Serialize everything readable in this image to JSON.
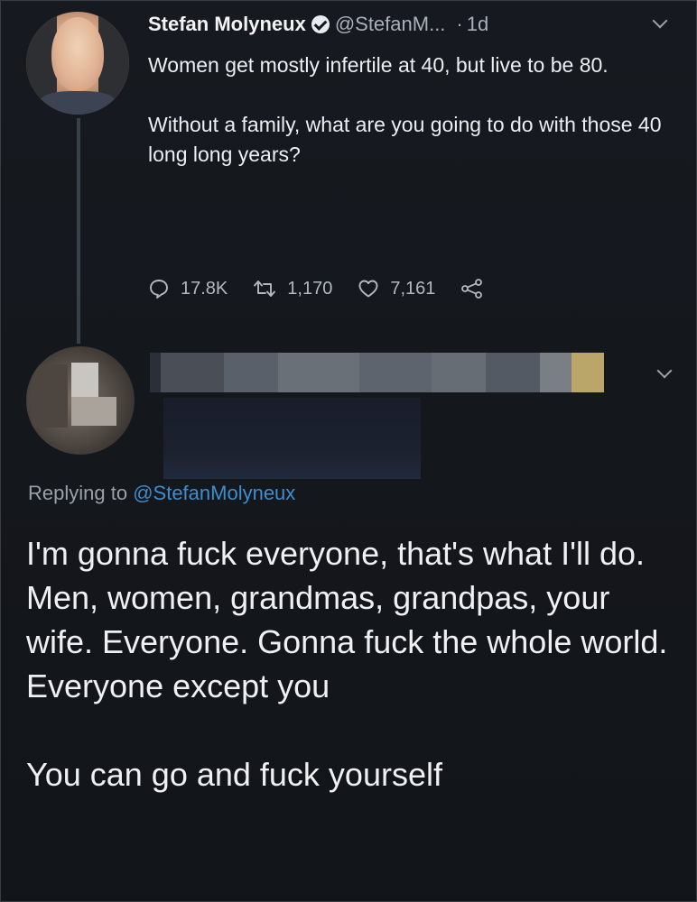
{
  "tweet": {
    "author_name": "Stefan Molyneux",
    "verified_icon": "verified-badge-icon",
    "handle": "@StefanM...",
    "separator": "·",
    "time": "1d",
    "paragraphs": [
      "Women get mostly infertile at 40, but live to be 80.",
      "Without a family, what are you going to do with those 40 long long years?"
    ],
    "actions": {
      "replies": "17.8K",
      "retweets": "1,170",
      "likes": "7,161"
    }
  },
  "reply": {
    "replying_prefix": "Replying to",
    "replying_mention": "@StefanMolyneux",
    "paragraphs": [
      "I'm gonna fuck everyone, that's what I'll do. Men, women, grandmas, grandpas, your wife. Everyone. Gonna fuck the whole world. Everyone except you",
      "You can go and fuck yourself"
    ]
  },
  "colors": {
    "background": "#15181d",
    "text": "#e9ecef",
    "muted": "#a9b0b8",
    "link": "#3f8ecf"
  },
  "icons": [
    "reply-icon",
    "retweet-icon",
    "like-icon",
    "share-icon",
    "chevron-down-icon"
  ]
}
